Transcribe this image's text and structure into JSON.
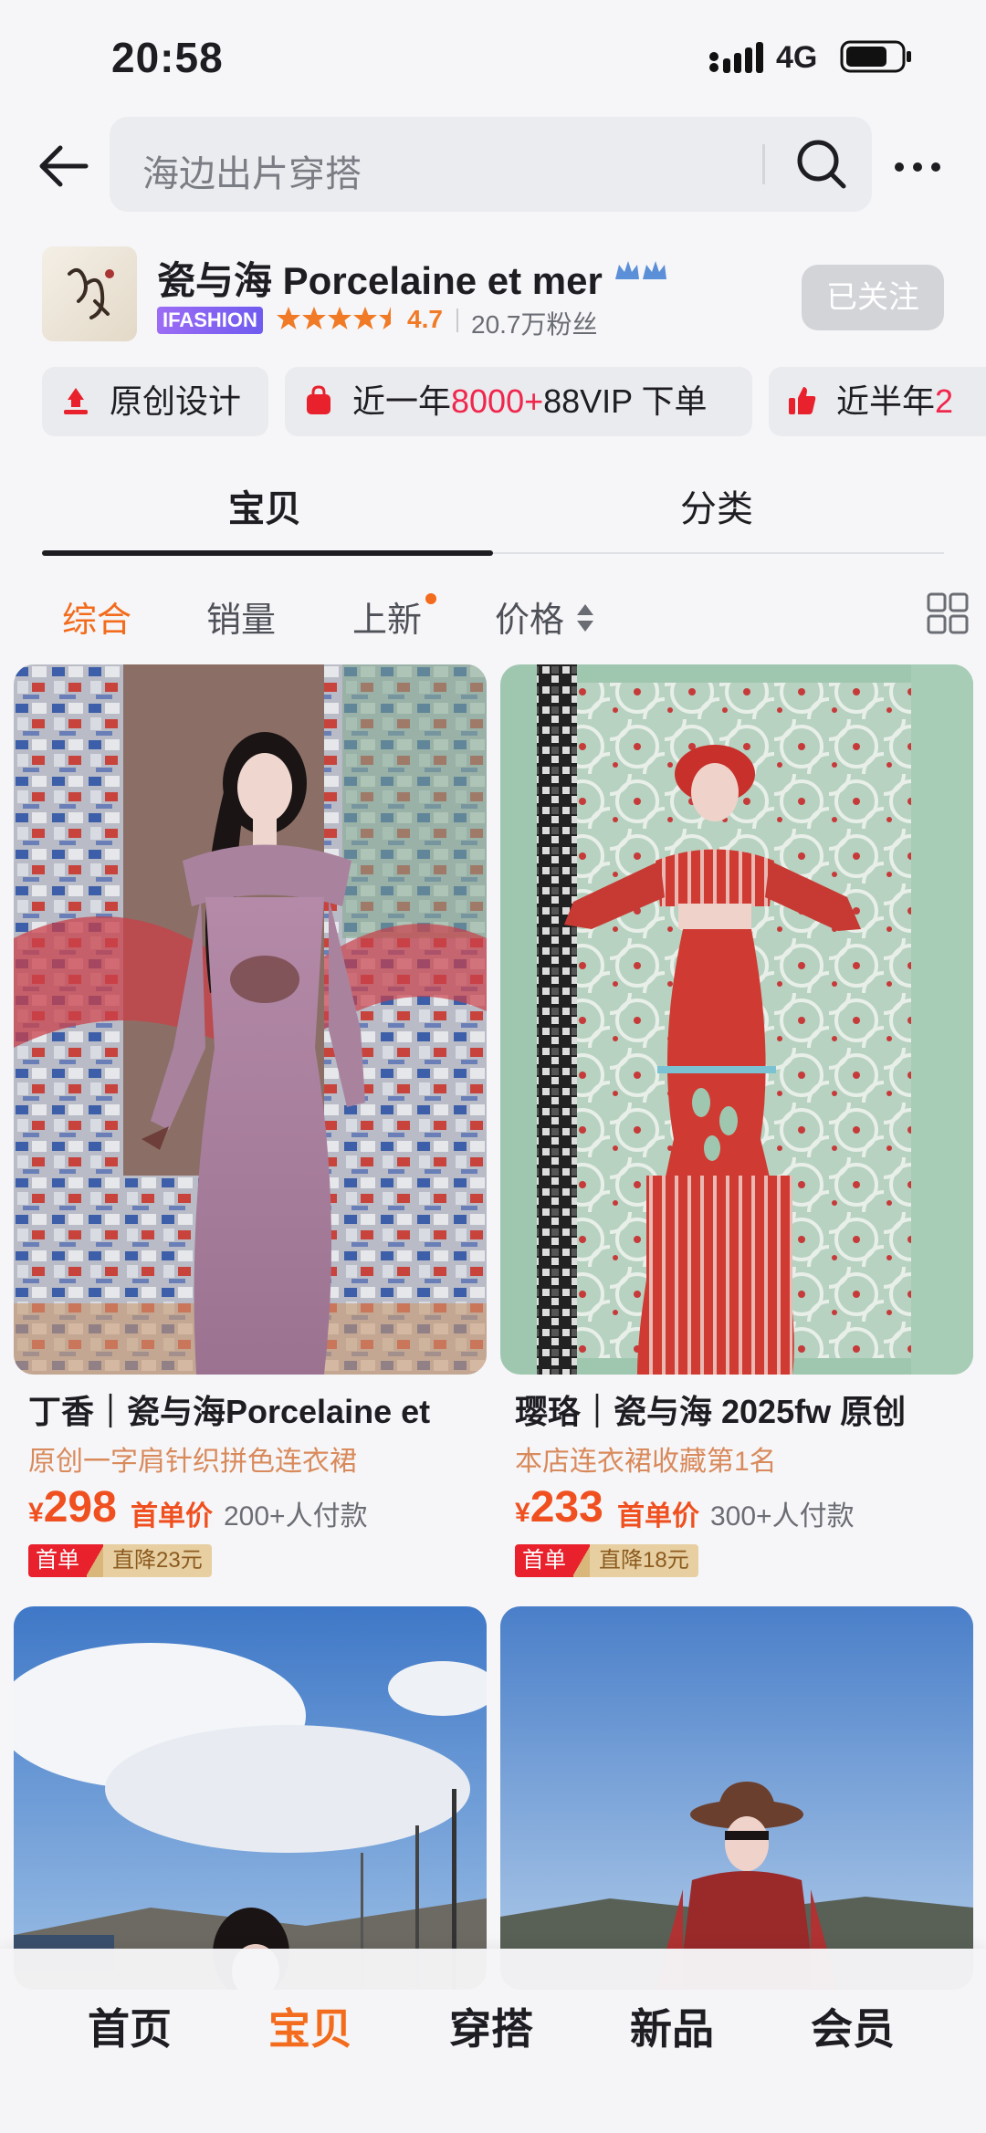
{
  "status": {
    "time": "20:58",
    "network": "4G"
  },
  "search": {
    "query": "海边出片穿搭"
  },
  "shop": {
    "name": "瓷与海 Porcelaine et mer",
    "badge": "IFASHION",
    "rating": "4.7",
    "fans": "20.7万粉丝",
    "follow_label": "已关注"
  },
  "tags": [
    {
      "icon": "design-icon",
      "label": "原创设计"
    },
    {
      "icon": "bag-icon",
      "label_pre": "近一年",
      "label_hl": "8000+",
      "label_post": "88VIP 下单"
    },
    {
      "icon": "thumbs-up-icon",
      "label_pre": "近半年",
      "label_hl": "2"
    }
  ],
  "tabs": [
    {
      "label": "宝贝"
    },
    {
      "label": "分类"
    }
  ],
  "sort": {
    "items": [
      "综合",
      "销量",
      "上新",
      "价格"
    ],
    "active": "综合"
  },
  "products": [
    {
      "title": "丁香｜瓷与海Porcelaine et",
      "subtitle": "原创一字肩针织拼色连衣裙",
      "currency": "¥",
      "price": "298",
      "price_label": "首单价",
      "buyers": "200+人付款",
      "promo_a": "首单",
      "promo_b": "直降23元"
    },
    {
      "title": "璎珞｜瓷与海  2025fw 原创",
      "subtitle": "本店连衣裙收藏第1名",
      "currency": "¥",
      "price": "233",
      "price_label": "首单价",
      "buyers": "300+人付款",
      "promo_a": "首单",
      "promo_b": "直降18元"
    }
  ],
  "bottom_nav": {
    "items": [
      "首页",
      "宝贝",
      "穿搭",
      "新品",
      "会员"
    ],
    "active": "宝贝"
  },
  "colors": {
    "accent": "#f36b1c",
    "price": "#f0501f",
    "highlight": "#f0264d"
  }
}
